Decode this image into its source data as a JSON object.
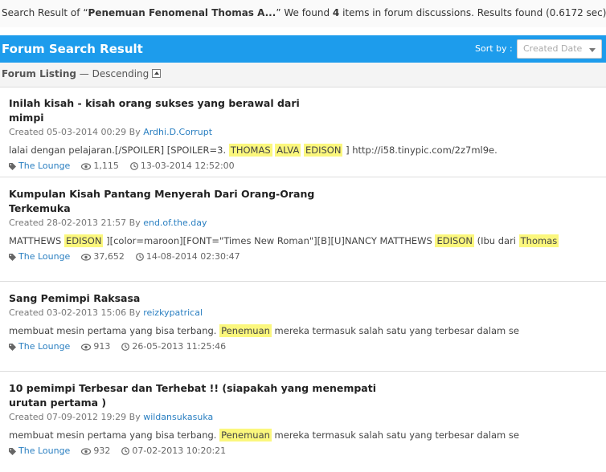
{
  "summary": {
    "prefix": "Search Result of “",
    "query": "Penemuan Fenomenal Thomas A...",
    "mid": "” We found ",
    "count": "4",
    "suffix": " items in forum discussions. Results found (0.6172 sec)"
  },
  "header": {
    "title": "Forum Search Result",
    "sort_label": "Sort by :",
    "sort_value": "Created Date"
  },
  "listing": {
    "label": "Forum Listing",
    "order": " — Descending"
  },
  "results": [
    {
      "title": "Inilah kisah - kisah orang sukses yang berawal dari mimpi",
      "created_prefix": "Created 05-03-2014 00:29 By ",
      "author": "Ardhi.D.Corrupt",
      "snippet": [
        {
          "t": "lalai dengan pelajaran.[/SPOILER] [SPOILER=3. ",
          "h": false
        },
        {
          "t": "THOMAS",
          "h": true
        },
        {
          "t": " ",
          "h": false
        },
        {
          "t": "ALVA",
          "h": true
        },
        {
          "t": " ",
          "h": false
        },
        {
          "t": "EDISON",
          "h": true
        },
        {
          "t": " ] http://i58.tinypic.com/2z7ml9e.",
          "h": false
        }
      ],
      "forum": "The Lounge",
      "views": "1,115",
      "last": "13-03-2014 12:52:00"
    },
    {
      "title": "Kumpulan Kisah Pantang Menyerah Dari Orang-Orang Terkemuka",
      "created_prefix": "Created 28-02-2013 21:57 By ",
      "author": "end.of.the.day",
      "snippet": [
        {
          "t": "MATTHEWS ",
          "h": false
        },
        {
          "t": "EDISON",
          "h": true
        },
        {
          "t": " ][color=maroon][FONT=\"Times New Roman\"][B][U]NANCY MATTHEWS ",
          "h": false
        },
        {
          "t": "EDISON",
          "h": true
        },
        {
          "t": " (Ibu dari ",
          "h": false
        },
        {
          "t": "Thomas",
          "h": true
        }
      ],
      "forum": "The Lounge",
      "views": "37,652",
      "last": "14-08-2014 02:30:47"
    },
    {
      "title": "Sang Pemimpi Raksasa",
      "created_prefix": "Created 03-02-2013 15:06 By ",
      "author": "reizkypatrical",
      "snippet": [
        {
          "t": "membuat mesin pertama yang bisa terbang. ",
          "h": false
        },
        {
          "t": "Penemuan",
          "h": true
        },
        {
          "t": " mereka termasuk salah satu yang terbesar dalam se",
          "h": false
        }
      ],
      "forum": "The Lounge",
      "views": "913",
      "last": "26-05-2013 11:25:46"
    },
    {
      "title": "10 pemimpi Terbesar dan Terhebat !! (siapakah yang menempati urutan pertama )",
      "created_prefix": "Created 07-09-2012 19:29 By ",
      "author": "wildansukasuka",
      "snippet": [
        {
          "t": "membuat mesin pertama yang bisa terbang. ",
          "h": false
        },
        {
          "t": "Penemuan",
          "h": true
        },
        {
          "t": " mereka termasuk salah satu yang terbesar dalam se",
          "h": false
        }
      ],
      "forum": "The Lounge",
      "views": "932",
      "last": "07-02-2013 10:20:21"
    }
  ]
}
